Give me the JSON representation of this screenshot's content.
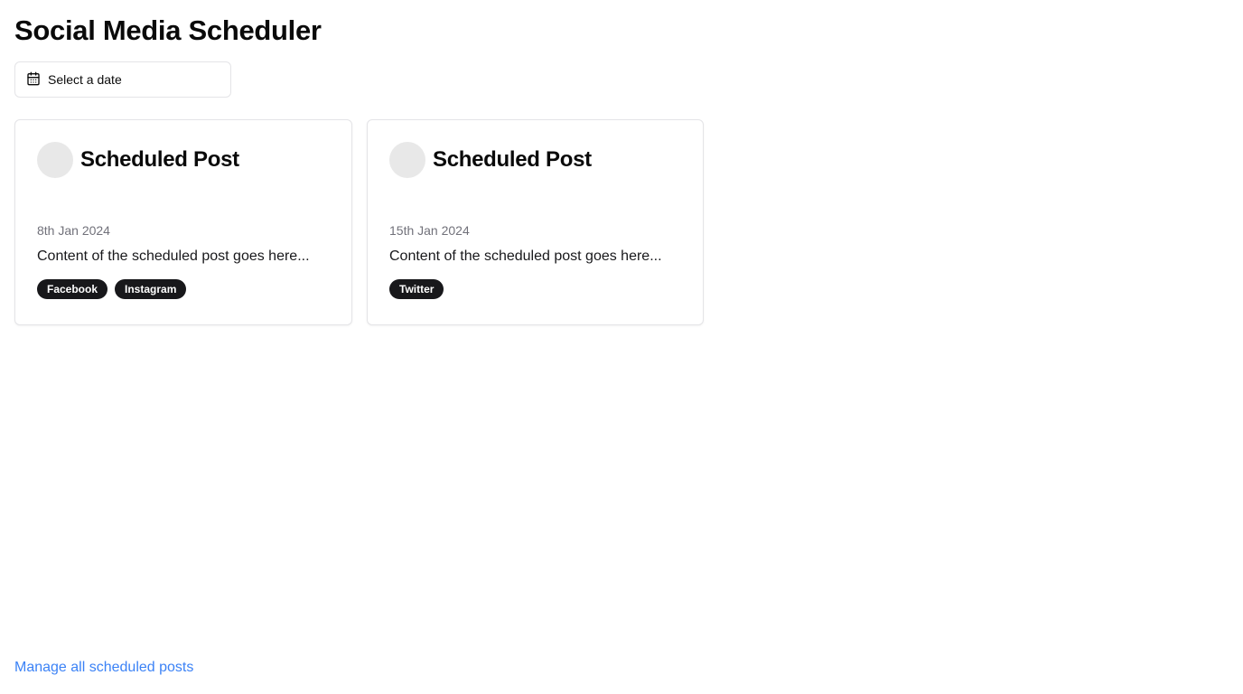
{
  "header": {
    "title": "Social Media Scheduler"
  },
  "date_picker": {
    "icon": "calendar-icon",
    "label": "Select a date"
  },
  "posts": [
    {
      "title": "Scheduled Post",
      "date": "8th Jan 2024",
      "content": "Content of the scheduled post goes here...",
      "platforms": [
        "Facebook",
        "Instagram"
      ]
    },
    {
      "title": "Scheduled Post",
      "date": "15th Jan 2024",
      "content": "Content of the scheduled post goes here...",
      "platforms": [
        "Twitter"
      ]
    }
  ],
  "footer": {
    "manage_link": "Manage all scheduled posts"
  },
  "colors": {
    "link": "#3b82f6",
    "badge_bg": "#18181b",
    "muted_text": "#71717a",
    "border": "#e4e4e7"
  }
}
